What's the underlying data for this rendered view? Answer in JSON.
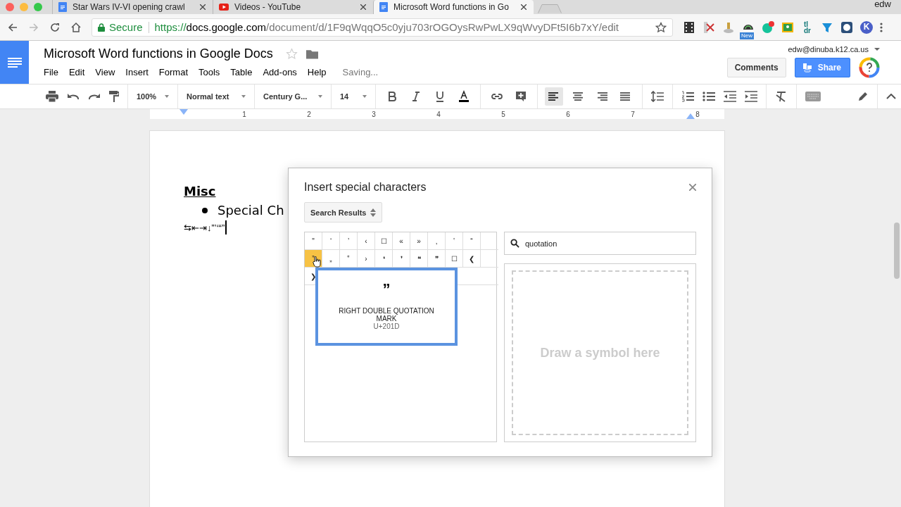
{
  "browser": {
    "tabs": [
      {
        "title": "Star Wars IV-VI opening crawl",
        "kind": "doc",
        "selected": false
      },
      {
        "title": "Videos - YouTube",
        "kind": "video",
        "selected": false
      },
      {
        "title": "Microsoft Word functions in Go",
        "kind": "doc",
        "selected": true
      }
    ],
    "profile": "edw",
    "secure_label": "Secure",
    "url": {
      "scheme": "https://",
      "host": "docs.google.com",
      "path": "/document/d/1F9qWqqO5c0yju703rOGOysRwPwLX9qWvyDFt5I6b7xY/edit"
    },
    "extensions": [
      {
        "kind": "film"
      },
      {
        "kind": "scissors"
      },
      {
        "kind": "plunger"
      },
      {
        "kind": "gauge",
        "badge": "New"
      },
      {
        "kind": "grammar"
      },
      {
        "kind": "classroom"
      },
      {
        "kind": "tldr",
        "label": "tl\ndr"
      },
      {
        "kind": "funnel"
      },
      {
        "kind": "screen"
      },
      {
        "kind": "k",
        "label": "K"
      }
    ]
  },
  "docs": {
    "title": "Microsoft Word functions in Google Docs",
    "menu": [
      "File",
      "Edit",
      "View",
      "Insert",
      "Format",
      "Tools",
      "Table",
      "Add-ons",
      "Help"
    ],
    "status": "Saving...",
    "account": "edw@dinuba.k12.ca.us",
    "comments_button": "Comments",
    "share_button": "Share"
  },
  "toolbar": {
    "zoom": "100%",
    "style": "Normal text",
    "font": "Century G...",
    "size": "14",
    "tools": [
      {
        "kind": "bold",
        "selected": false
      },
      {
        "kind": "italic",
        "selected": false
      },
      {
        "kind": "underline",
        "selected": false
      },
      {
        "kind": "text-color",
        "selected": false
      },
      {
        "kind": "link",
        "selected": false
      },
      {
        "kind": "comment",
        "selected": false
      },
      {
        "kind": "align-left",
        "selected": true
      },
      {
        "kind": "align-center",
        "selected": false
      },
      {
        "kind": "align-right",
        "selected": false
      },
      {
        "kind": "justify",
        "selected": false
      }
    ]
  },
  "ruler": [
    "1",
    "2",
    "3",
    "4",
    "5",
    "6",
    "7",
    "8"
  ],
  "document": {
    "heading": "Misc",
    "bullet": "Special Ch",
    "inserted_text": "⇆⇤⇥↓‟‛‘“”"
  },
  "dialog": {
    "title": "Insert special characters",
    "category": "Search Results",
    "search": "quotation",
    "draw_placeholder": "Draw a symbol here",
    "characters": [
      [
        {
          "char": "\"",
          "selected": false
        },
        {
          "char": "‘",
          "selected": false
        },
        {
          "char": "’",
          "selected": false
        },
        {
          "char": "‹",
          "selected": false
        },
        {
          "char": "☐",
          "selected": false
        },
        {
          "char": "«",
          "selected": false
        },
        {
          "char": "»",
          "selected": false
        },
        {
          "char": "‚",
          "selected": false
        },
        {
          "char": "‛",
          "selected": false
        },
        {
          "char": "“",
          "selected": false
        }
      ],
      [
        {
          "char": "”",
          "selected": true
        },
        {
          "char": "„",
          "selected": false
        },
        {
          "char": "‟",
          "selected": false
        },
        {
          "char": "›",
          "selected": false
        },
        {
          "char": "❛",
          "selected": false
        },
        {
          "char": "❜",
          "selected": false
        },
        {
          "char": "❝",
          "selected": false
        },
        {
          "char": "❞",
          "selected": false
        },
        {
          "char": "☐",
          "selected": false
        },
        {
          "char": "❮",
          "selected": false
        }
      ],
      [
        {
          "char": "❯",
          "selected": false
        }
      ]
    ],
    "preview": {
      "char": "”",
      "name": "RIGHT DOUBLE QUOTATION MARK",
      "code": "U+201D"
    }
  }
}
